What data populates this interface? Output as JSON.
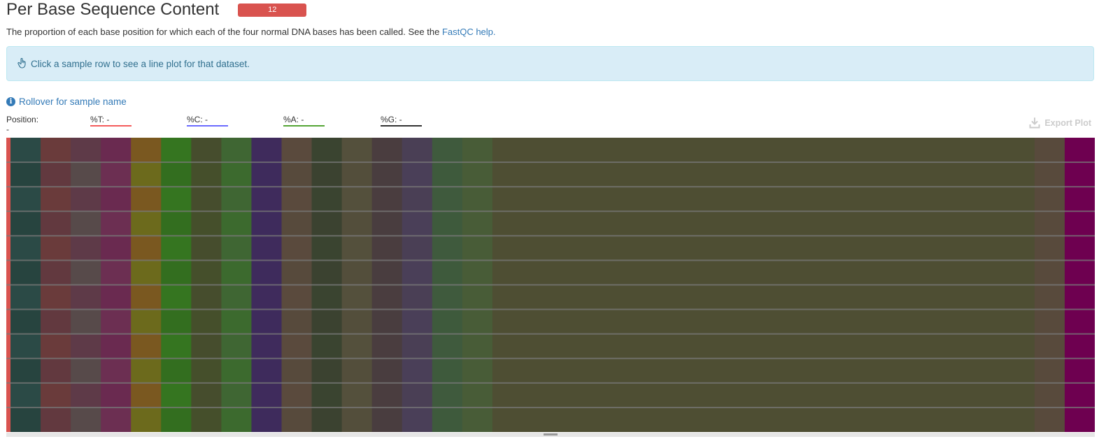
{
  "section": {
    "title": "Per Base Sequence Content",
    "status_count": "12",
    "status_color": "#d9534f"
  },
  "description": {
    "text": "The proportion of each base position for which each of the four normal DNA bases has been called. See the ",
    "link_text": "FastQC help.",
    "link_color": "#337ab7"
  },
  "info_box": {
    "text": "Click a sample row to see a line plot for that dataset.",
    "icon": "pointing-hand-icon"
  },
  "rollover": {
    "text": "Rollover for sample name",
    "icon": "info-circle-icon"
  },
  "readouts": {
    "position": "Position: -",
    "t": {
      "label": "%T: -",
      "color": "#f45b5b"
    },
    "c": {
      "label": "%C: -",
      "color": "#6b6bff"
    },
    "a": {
      "label": "%A: -",
      "color": "#55a535"
    },
    "g": {
      "label": "%G: -",
      "color": "#333333"
    }
  },
  "export_button": {
    "label": "Export Plot",
    "icon": "download-icon"
  },
  "heatmap": {
    "rows": 12,
    "row_status_color": "#d9534f",
    "columns": [
      {
        "cols": 1,
        "color": "#2b4a46",
        "alt": "#27443f"
      },
      {
        "cols": 1,
        "color": "#6a3b3b",
        "alt": "#62393f"
      },
      {
        "cols": 1,
        "color": "#5e3a48",
        "alt": "#574a4a"
      },
      {
        "cols": 1,
        "color": "#6a2a50",
        "alt": "#6c2f52"
      },
      {
        "cols": 1,
        "color": "#7a5820",
        "alt": "#6c6a1c"
      },
      {
        "cols": 1,
        "color": "#357520",
        "alt": "#336e1f"
      },
      {
        "cols": 1,
        "color": "#464d2d",
        "alt": "#454f2b"
      },
      {
        "cols": 1,
        "color": "#3f6633",
        "alt": "#3c6a2e"
      },
      {
        "cols": 1,
        "color": "#3f2b5c",
        "alt": "#3e2b5c"
      },
      {
        "cols": 1,
        "color": "#5a4a3d",
        "alt": "#574a3c"
      },
      {
        "cols": 1,
        "color": "#3a4430",
        "alt": "#3b4230"
      },
      {
        "cols": 1,
        "color": "#54503c",
        "alt": "#534e3b"
      },
      {
        "cols": 1,
        "color": "#4a3d3f",
        "alt": "#493d3f"
      },
      {
        "cols": 1,
        "color": "#4a3f55",
        "alt": "#4a3f58"
      },
      {
        "cols": 1,
        "color": "#3f5a3d",
        "alt": "#3e5a3c"
      },
      {
        "cols": 1,
        "color": "#485c37",
        "alt": "#485c37"
      },
      {
        "cols": 18,
        "color": "#4e4e33",
        "alt": "#4e4e33"
      },
      {
        "cols": 1,
        "color": "#584a3c",
        "alt": "#584a3c"
      },
      {
        "cols": 1,
        "color": "#6e0050",
        "alt": "#6e0050"
      }
    ]
  }
}
